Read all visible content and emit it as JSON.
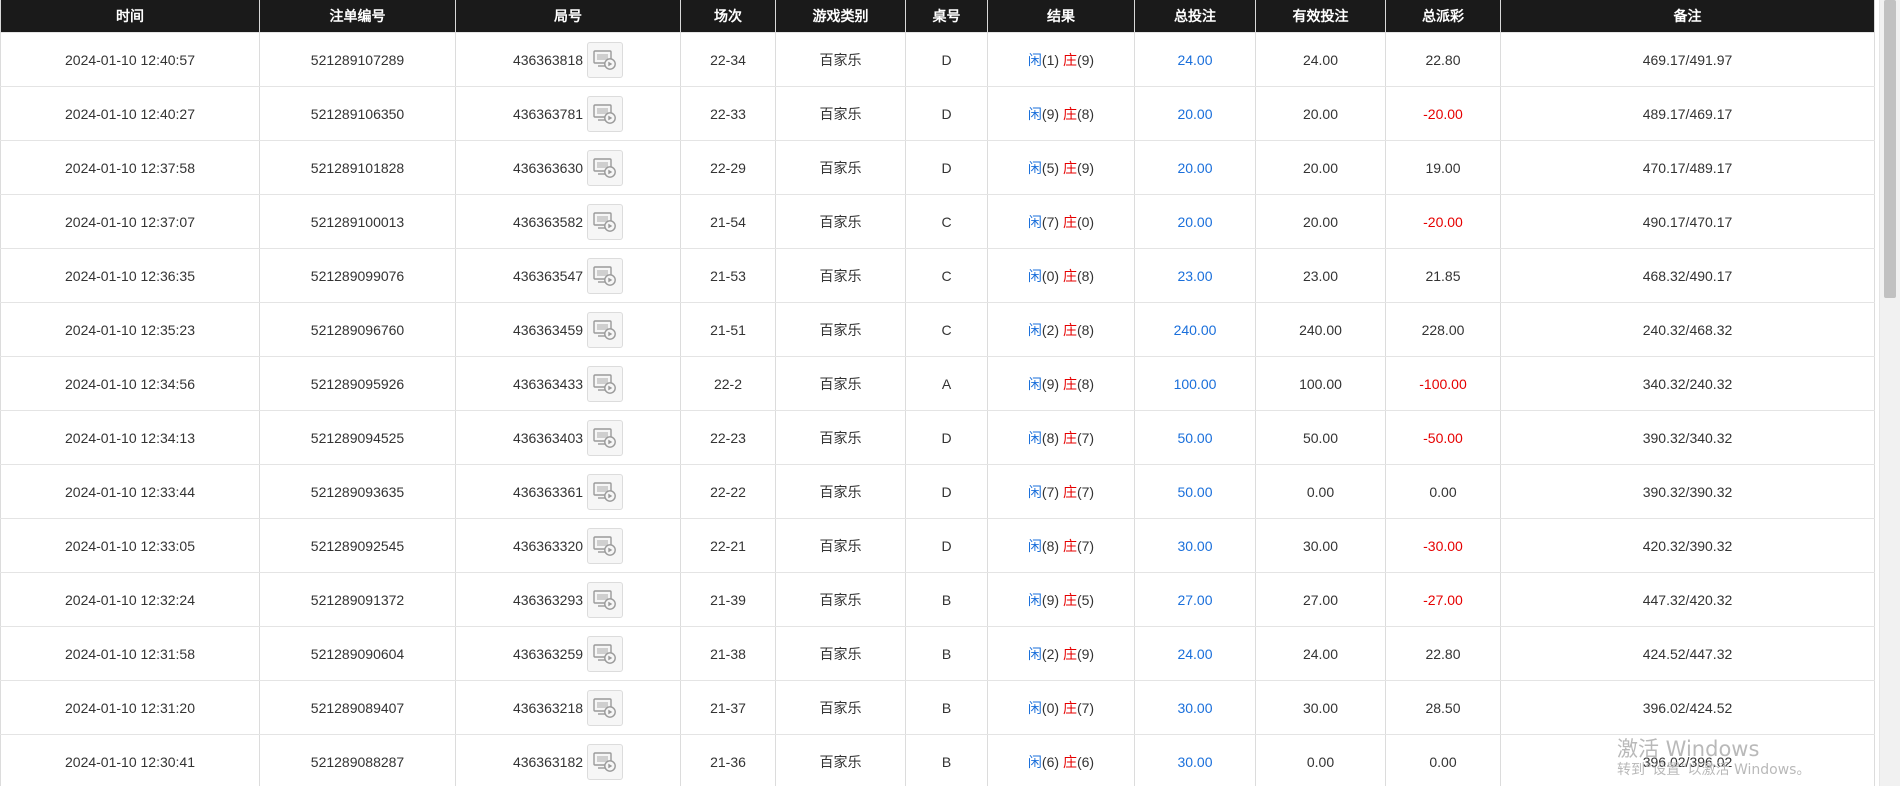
{
  "columns": [
    "时间",
    "注单编号",
    "局号",
    "场次",
    "游戏类别",
    "桌号",
    "结果",
    "总投注",
    "有效投注",
    "总派彩",
    "备注"
  ],
  "result_labels": {
    "player": "闲",
    "banker": "庄"
  },
  "colors": {
    "header_bg": "#1a1a1a",
    "blue": "#1a6fdb",
    "red": "#e60000"
  },
  "rows": [
    {
      "time": "2024-01-10 12:40:57",
      "bet_id": "521289107289",
      "round_id": "436363818",
      "session": "22-34",
      "game": "百家乐",
      "table": "D",
      "player": "(1)",
      "banker": "(9)",
      "total_bet": "24.00",
      "valid_bet": "24.00",
      "payout": "22.80",
      "payout_negative": false,
      "remark": "469.17/491.97"
    },
    {
      "time": "2024-01-10 12:40:27",
      "bet_id": "521289106350",
      "round_id": "436363781",
      "session": "22-33",
      "game": "百家乐",
      "table": "D",
      "player": "(9)",
      "banker": "(8)",
      "total_bet": "20.00",
      "valid_bet": "20.00",
      "payout": "-20.00",
      "payout_negative": true,
      "remark": "489.17/469.17"
    },
    {
      "time": "2024-01-10 12:37:58",
      "bet_id": "521289101828",
      "round_id": "436363630",
      "session": "22-29",
      "game": "百家乐",
      "table": "D",
      "player": "(5)",
      "banker": "(9)",
      "total_bet": "20.00",
      "valid_bet": "20.00",
      "payout": "19.00",
      "payout_negative": false,
      "remark": "470.17/489.17"
    },
    {
      "time": "2024-01-10 12:37:07",
      "bet_id": "521289100013",
      "round_id": "436363582",
      "session": "21-54",
      "game": "百家乐",
      "table": "C",
      "player": "(7)",
      "banker": "(0)",
      "total_bet": "20.00",
      "valid_bet": "20.00",
      "payout": "-20.00",
      "payout_negative": true,
      "remark": "490.17/470.17"
    },
    {
      "time": "2024-01-10 12:36:35",
      "bet_id": "521289099076",
      "round_id": "436363547",
      "session": "21-53",
      "game": "百家乐",
      "table": "C",
      "player": "(0)",
      "banker": "(8)",
      "total_bet": "23.00",
      "valid_bet": "23.00",
      "payout": "21.85",
      "payout_negative": false,
      "remark": "468.32/490.17"
    },
    {
      "time": "2024-01-10 12:35:23",
      "bet_id": "521289096760",
      "round_id": "436363459",
      "session": "21-51",
      "game": "百家乐",
      "table": "C",
      "player": "(2)",
      "banker": "(8)",
      "total_bet": "240.00",
      "valid_bet": "240.00",
      "payout": "228.00",
      "payout_negative": false,
      "remark": "240.32/468.32"
    },
    {
      "time": "2024-01-10 12:34:56",
      "bet_id": "521289095926",
      "round_id": "436363433",
      "session": "22-2",
      "game": "百家乐",
      "table": "A",
      "player": "(9)",
      "banker": "(8)",
      "total_bet": "100.00",
      "valid_bet": "100.00",
      "payout": "-100.00",
      "payout_negative": true,
      "remark": "340.32/240.32"
    },
    {
      "time": "2024-01-10 12:34:13",
      "bet_id": "521289094525",
      "round_id": "436363403",
      "session": "22-23",
      "game": "百家乐",
      "table": "D",
      "player": "(8)",
      "banker": "(7)",
      "total_bet": "50.00",
      "valid_bet": "50.00",
      "payout": "-50.00",
      "payout_negative": true,
      "remark": "390.32/340.32"
    },
    {
      "time": "2024-01-10 12:33:44",
      "bet_id": "521289093635",
      "round_id": "436363361",
      "session": "22-22",
      "game": "百家乐",
      "table": "D",
      "player": "(7)",
      "banker": "(7)",
      "total_bet": "50.00",
      "valid_bet": "0.00",
      "payout": "0.00",
      "payout_negative": false,
      "remark": "390.32/390.32"
    },
    {
      "time": "2024-01-10 12:33:05",
      "bet_id": "521289092545",
      "round_id": "436363320",
      "session": "22-21",
      "game": "百家乐",
      "table": "D",
      "player": "(8)",
      "banker": "(7)",
      "total_bet": "30.00",
      "valid_bet": "30.00",
      "payout": "-30.00",
      "payout_negative": true,
      "remark": "420.32/390.32"
    },
    {
      "time": "2024-01-10 12:32:24",
      "bet_id": "521289091372",
      "round_id": "436363293",
      "session": "21-39",
      "game": "百家乐",
      "table": "B",
      "player": "(9)",
      "banker": "(5)",
      "total_bet": "27.00",
      "valid_bet": "27.00",
      "payout": "-27.00",
      "payout_negative": true,
      "remark": "447.32/420.32"
    },
    {
      "time": "2024-01-10 12:31:58",
      "bet_id": "521289090604",
      "round_id": "436363259",
      "session": "21-38",
      "game": "百家乐",
      "table": "B",
      "player": "(2)",
      "banker": "(9)",
      "total_bet": "24.00",
      "valid_bet": "24.00",
      "payout": "22.80",
      "payout_negative": false,
      "remark": "424.52/447.32"
    },
    {
      "time": "2024-01-10 12:31:20",
      "bet_id": "521289089407",
      "round_id": "436363218",
      "session": "21-37",
      "game": "百家乐",
      "table": "B",
      "player": "(0)",
      "banker": "(7)",
      "total_bet": "30.00",
      "valid_bet": "30.00",
      "payout": "28.50",
      "payout_negative": false,
      "remark": "396.02/424.52"
    },
    {
      "time": "2024-01-10 12:30:41",
      "bet_id": "521289088287",
      "round_id": "436363182",
      "session": "21-36",
      "game": "百家乐",
      "table": "B",
      "player": "(6)",
      "banker": "(6)",
      "total_bet": "30.00",
      "valid_bet": "0.00",
      "payout": "0.00",
      "payout_negative": false,
      "remark": "396.02/396.02"
    }
  ],
  "watermark": {
    "title": "激活 Windows",
    "subtitle": "转到“设置”以激活 Windows。"
  }
}
